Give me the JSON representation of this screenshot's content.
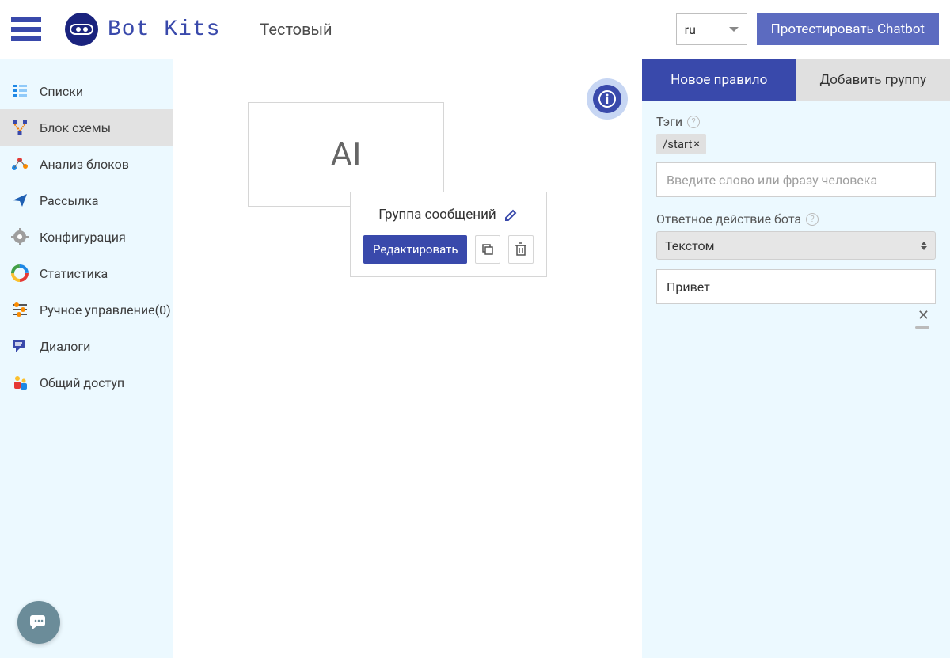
{
  "header": {
    "logo_text": "Bot Kits",
    "project_name": "Тестовый",
    "language": "ru",
    "test_button": "Протестировать Chatbot"
  },
  "sidebar": {
    "items": [
      {
        "label": "Списки",
        "icon": "lists-icon"
      },
      {
        "label": "Блок схемы",
        "icon": "flowchart-icon"
      },
      {
        "label": "Анализ блоков",
        "icon": "analysis-icon"
      },
      {
        "label": "Рассылка",
        "icon": "send-icon"
      },
      {
        "label": "Конфигурация",
        "icon": "gear-icon"
      },
      {
        "label": "Статистика",
        "icon": "stats-icon"
      },
      {
        "label": "Ручное управление(0)",
        "icon": "manual-icon"
      },
      {
        "label": "Диалоги",
        "icon": "dialog-icon"
      },
      {
        "label": "Общий доступ",
        "icon": "share-icon"
      }
    ],
    "active_index": 1
  },
  "canvas": {
    "ai_node_label": "AI",
    "message_card": {
      "title": "Группа сообщений",
      "edit_button": "Редактировать"
    }
  },
  "right_panel": {
    "tabs": {
      "new_rule": "Новое правило",
      "add_group": "Добавить группу",
      "active": "new_rule"
    },
    "tags_label": "Тэги",
    "tag_value": "/start",
    "phrase_placeholder": "Введите слово или фразу человека",
    "action_label": "Ответное действие бота",
    "action_select_value": "Текстом",
    "reply_value": "Привет"
  }
}
